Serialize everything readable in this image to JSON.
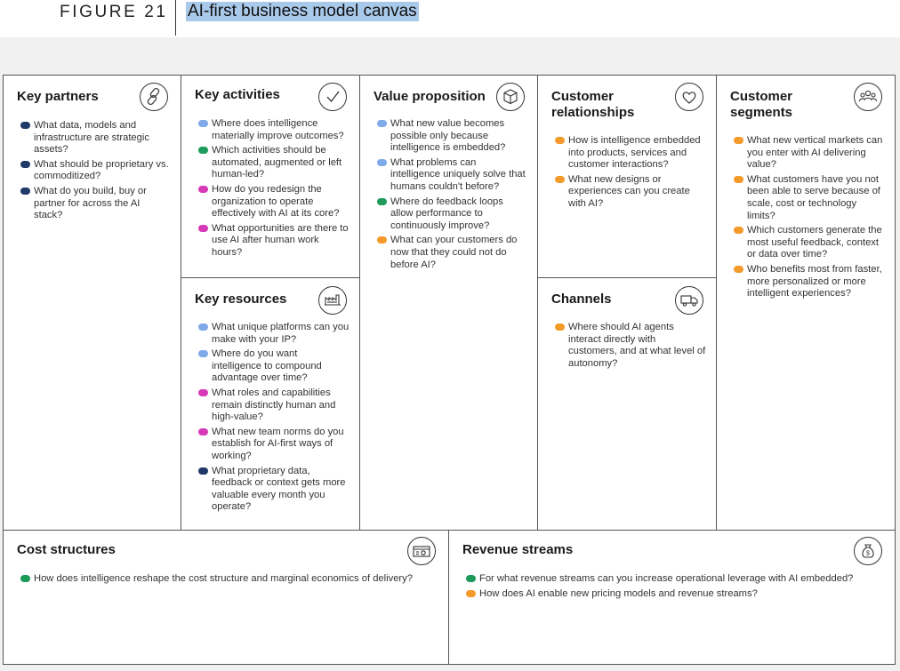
{
  "header": {
    "figure_label": "FIGURE 21",
    "title": "AI-first business model canvas"
  },
  "colors": {
    "navy": "#1f3a68",
    "light_blue": "#7fa9e8",
    "green": "#1e9a5a",
    "pink": "#d63ab7",
    "orange": "#f39a2b",
    "title_highlight": "#a9c9ea"
  },
  "key_partners": {
    "title": "Key partners",
    "icon": "link-icon",
    "questions": [
      {
        "color": "navy",
        "text": "What data, models and infrastructure are strategic assets?"
      },
      {
        "color": "navy",
        "text": "What should be proprietary vs. commoditized?"
      },
      {
        "color": "navy",
        "text": "What do you build, buy or partner for across the AI stack?"
      }
    ]
  },
  "key_activities": {
    "title": "Key activities",
    "icon": "checkmark-icon",
    "questions": [
      {
        "color": "light_blue",
        "text": "Where does intelligence materially improve outcomes?"
      },
      {
        "color": "green",
        "text": "Which activities should be automated, augmented or left human-led?"
      },
      {
        "color": "pink",
        "text": "How do you redesign the organization to operate effectively with AI at its core?"
      },
      {
        "color": "pink",
        "text": "What opportunities are there to use AI after human work hours?"
      }
    ]
  },
  "value_proposition": {
    "title": "Value proposition",
    "icon": "cube-icon",
    "questions": [
      {
        "color": "light_blue",
        "text": "What new value becomes possible only because intelligence is embedded?"
      },
      {
        "color": "light_blue",
        "text": "What problems can intelligence uniquely solve that humans couldn't before?"
      },
      {
        "color": "green",
        "text": "Where do feedback loops allow performance to continuously improve?"
      },
      {
        "color": "orange",
        "text": "What can your customers do now that they could not do before AI?"
      }
    ]
  },
  "customer_relationships": {
    "title": "Customer relationships",
    "icon": "heart-icon",
    "questions": [
      {
        "color": "orange",
        "text": "How is intelligence embedded into products, services and customer interactions?"
      },
      {
        "color": "orange",
        "text": "What new designs or experiences can you create with AI?"
      }
    ]
  },
  "customer_segments": {
    "title": "Customer segments",
    "icon": "people-icon",
    "questions": [
      {
        "color": "orange",
        "text": "What new vertical markets can you enter with AI delivering value?"
      },
      {
        "color": "orange",
        "text": "What customers have you not been able to serve because of scale, cost or technology limits?"
      },
      {
        "color": "orange",
        "text": "Which customers generate the most useful feedback, context or data over time?"
      },
      {
        "color": "orange",
        "text": "Who benefits most from faster, more personalized or more intelligent experiences?"
      }
    ]
  },
  "key_resources": {
    "title": "Key resources",
    "icon": "factory-icon",
    "questions": [
      {
        "color": "light_blue",
        "text": "What unique platforms can you make with your IP?"
      },
      {
        "color": "light_blue",
        "text": "Where do you want intelligence to compound advantage over time?"
      },
      {
        "color": "pink",
        "text": "What roles and capabilities remain distinctly human and high-value?"
      },
      {
        "color": "pink",
        "text": "What new team norms do you establish for AI-first ways of working?"
      },
      {
        "color": "navy",
        "text": "What proprietary data, feedback or context gets more valuable every month you operate?"
      }
    ]
  },
  "channels": {
    "title": "Channels",
    "icon": "truck-icon",
    "questions": [
      {
        "color": "orange",
        "text": "Where should AI agents interact directly with customers, and at what level of autonomy?"
      }
    ]
  },
  "cost_structures": {
    "title": "Cost structures",
    "icon": "cash-register-icon",
    "questions": [
      {
        "color": "green",
        "text": "How does intelligence reshape the cost structure and marginal economics of delivery?"
      }
    ]
  },
  "revenue_streams": {
    "title": "Revenue streams",
    "icon": "money-bag-icon",
    "questions": [
      {
        "color": "green",
        "text": "For what revenue streams can you increase operational leverage with AI embedded?"
      },
      {
        "color": "orange",
        "text": "How does AI enable new pricing models and revenue streams?"
      }
    ]
  }
}
